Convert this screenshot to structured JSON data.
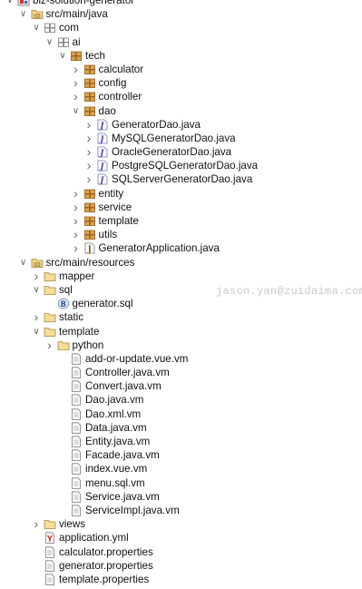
{
  "watermark": "jason.yan@zuidaima.com",
  "tree": [
    {
      "label": "biz-solution-generator",
      "depth": 0,
      "toggle": "expanded",
      "icon": "project"
    },
    {
      "label": "src/main/java",
      "depth": 1,
      "toggle": "expanded",
      "icon": "source-folder"
    },
    {
      "label": "com",
      "depth": 2,
      "toggle": "expanded",
      "icon": "package-empty"
    },
    {
      "label": "ai",
      "depth": 3,
      "toggle": "expanded",
      "icon": "package-empty"
    },
    {
      "label": "tech",
      "depth": 4,
      "toggle": "expanded",
      "icon": "package"
    },
    {
      "label": "calculator",
      "depth": 5,
      "toggle": "collapsed",
      "icon": "package"
    },
    {
      "label": "config",
      "depth": 5,
      "toggle": "collapsed",
      "icon": "package"
    },
    {
      "label": "controller",
      "depth": 5,
      "toggle": "collapsed",
      "icon": "package"
    },
    {
      "label": "dao",
      "depth": 5,
      "toggle": "expanded",
      "icon": "package"
    },
    {
      "label": "GeneratorDao.java",
      "depth": 6,
      "toggle": "collapsed",
      "icon": "java-interface"
    },
    {
      "label": "MySQLGeneratorDao.java",
      "depth": 6,
      "toggle": "collapsed",
      "icon": "java-interface"
    },
    {
      "label": "OracleGeneratorDao.java",
      "depth": 6,
      "toggle": "collapsed",
      "icon": "java-interface"
    },
    {
      "label": "PostgreSQLGeneratorDao.java",
      "depth": 6,
      "toggle": "collapsed",
      "icon": "java-interface"
    },
    {
      "label": "SQLServerGeneratorDao.java",
      "depth": 6,
      "toggle": "collapsed",
      "icon": "java-interface"
    },
    {
      "label": "entity",
      "depth": 5,
      "toggle": "collapsed",
      "icon": "package"
    },
    {
      "label": "service",
      "depth": 5,
      "toggle": "collapsed",
      "icon": "package"
    },
    {
      "label": "template",
      "depth": 5,
      "toggle": "collapsed",
      "icon": "package"
    },
    {
      "label": "utils",
      "depth": 5,
      "toggle": "collapsed",
      "icon": "package"
    },
    {
      "label": "GeneratorApplication.java",
      "depth": 5,
      "toggle": "collapsed",
      "icon": "java-class"
    },
    {
      "label": "src/main/resources",
      "depth": 1,
      "toggle": "expanded",
      "icon": "source-folder"
    },
    {
      "label": "mapper",
      "depth": 2,
      "toggle": "collapsed",
      "icon": "folder"
    },
    {
      "label": "sql",
      "depth": 2,
      "toggle": "expanded",
      "icon": "folder"
    },
    {
      "label": "generator.sql",
      "depth": 3,
      "toggle": "none",
      "icon": "sql-file"
    },
    {
      "label": "static",
      "depth": 2,
      "toggle": "collapsed",
      "icon": "folder"
    },
    {
      "label": "template",
      "depth": 2,
      "toggle": "expanded",
      "icon": "folder"
    },
    {
      "label": "python",
      "depth": 3,
      "toggle": "collapsed",
      "icon": "folder"
    },
    {
      "label": "add-or-update.vue.vm",
      "depth": 4,
      "toggle": "none",
      "icon": "file"
    },
    {
      "label": "Controller.java.vm",
      "depth": 4,
      "toggle": "none",
      "icon": "file"
    },
    {
      "label": "Convert.java.vm",
      "depth": 4,
      "toggle": "none",
      "icon": "file"
    },
    {
      "label": "Dao.java.vm",
      "depth": 4,
      "toggle": "none",
      "icon": "file"
    },
    {
      "label": "Dao.xml.vm",
      "depth": 4,
      "toggle": "none",
      "icon": "file"
    },
    {
      "label": "Data.java.vm",
      "depth": 4,
      "toggle": "none",
      "icon": "file"
    },
    {
      "label": "Entity.java.vm",
      "depth": 4,
      "toggle": "none",
      "icon": "file"
    },
    {
      "label": "Facade.java.vm",
      "depth": 4,
      "toggle": "none",
      "icon": "file"
    },
    {
      "label": "index.vue.vm",
      "depth": 4,
      "toggle": "none",
      "icon": "file"
    },
    {
      "label": "menu.sql.vm",
      "depth": 4,
      "toggle": "none",
      "icon": "file"
    },
    {
      "label": "Service.java.vm",
      "depth": 4,
      "toggle": "none",
      "icon": "file"
    },
    {
      "label": "ServiceImpl.java.vm",
      "depth": 4,
      "toggle": "none",
      "icon": "file"
    },
    {
      "label": "views",
      "depth": 2,
      "toggle": "collapsed",
      "icon": "folder"
    },
    {
      "label": "application.yml",
      "depth": 2,
      "toggle": "none",
      "icon": "yaml-file"
    },
    {
      "label": "calculator.properties",
      "depth": 2,
      "toggle": "none",
      "icon": "file"
    },
    {
      "label": "generator.properties",
      "depth": 2,
      "toggle": "none",
      "icon": "file"
    },
    {
      "label": "template.properties",
      "depth": 2,
      "toggle": "none",
      "icon": "file"
    }
  ]
}
